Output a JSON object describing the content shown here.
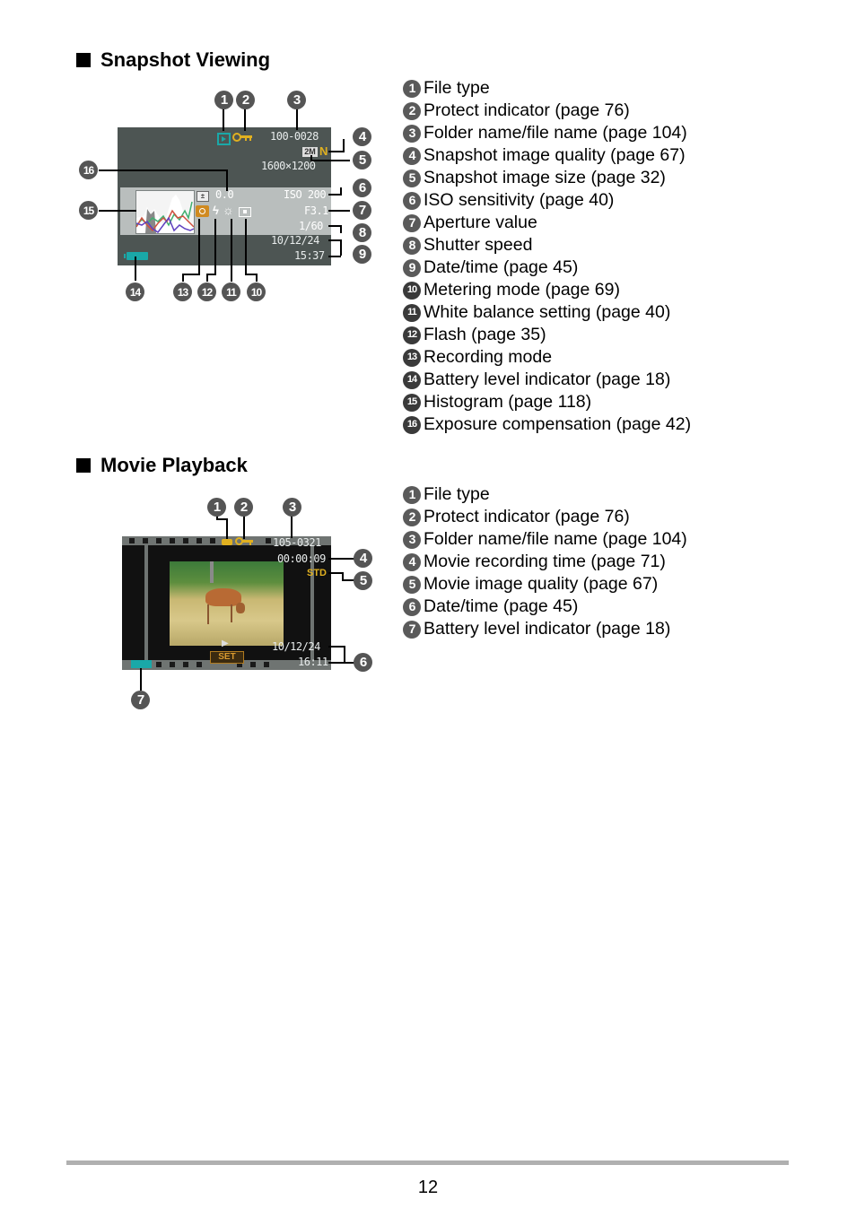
{
  "sections": [
    {
      "title": "Snapshot Viewing",
      "screen": {
        "folder_file": "100-0028",
        "quality": "N",
        "size_icon": "2M",
        "image_size": "1600×1200",
        "ev": "0.0",
        "iso": "ISO 200",
        "aperture": "F3.1",
        "shutter": "1/60",
        "date": "10/12/24",
        "time": "15:37",
        "icons": [
          "playback-file-icon",
          "protect-key-icon",
          "exposure-comp-icon",
          "camera-recording-mode-icon",
          "flash-icon",
          "white-balance-icon",
          "metering-icon",
          "battery-icon",
          "histogram"
        ]
      },
      "items": [
        {
          "n": "1",
          "label": "File type"
        },
        {
          "n": "2",
          "label": "Protect indicator (page 76)"
        },
        {
          "n": "3",
          "label": "Folder name/file name (page 104)"
        },
        {
          "n": "4",
          "label": "Snapshot image quality (page 67)"
        },
        {
          "n": "5",
          "label": "Snapshot image size (page 32)"
        },
        {
          "n": "6",
          "label": "ISO sensitivity (page 40)"
        },
        {
          "n": "7",
          "label": "Aperture value"
        },
        {
          "n": "8",
          "label": "Shutter speed"
        },
        {
          "n": "9",
          "label": "Date/time (page 45)"
        },
        {
          "n": "10",
          "label": "Metering mode (page 69)"
        },
        {
          "n": "11",
          "label": "White balance setting (page 40)"
        },
        {
          "n": "12",
          "label": "Flash (page 35)"
        },
        {
          "n": "13",
          "label": "Recording mode"
        },
        {
          "n": "14",
          "label": "Battery level indicator (page 18)"
        },
        {
          "n": "15",
          "label": "Histogram (page 118)"
        },
        {
          "n": "16",
          "label": "Exposure compensation (page 42)"
        }
      ]
    },
    {
      "title": "Movie Playback",
      "screen": {
        "folder_file": "105-0321",
        "rec_time": "00:00:09",
        "quality": "STD",
        "date": "10/12/24",
        "time": "16:11",
        "set_label": "SET",
        "play_glyph": "▶"
      },
      "items": [
        {
          "n": "1",
          "label": "File type"
        },
        {
          "n": "2",
          "label": "Protect indicator (page 76)"
        },
        {
          "n": "3",
          "label": "Folder name/file name (page 104)"
        },
        {
          "n": "4",
          "label": "Movie recording time (page 71)"
        },
        {
          "n": "5",
          "label": "Movie image quality (page 67)"
        },
        {
          "n": "6",
          "label": "Date/time (page 45)"
        },
        {
          "n": "7",
          "label": "Battery level indicator (page 18)"
        }
      ]
    }
  ],
  "page_number": "12",
  "colors": {
    "lcd_bg": "#4d5553",
    "accent_yellow": "#e0b020",
    "teal": "#1aa8a8",
    "orange": "#d08a20",
    "rule": "#b0b0b0"
  }
}
